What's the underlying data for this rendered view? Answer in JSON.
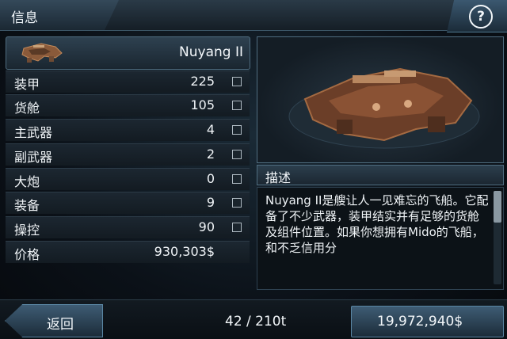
{
  "header": {
    "title": "信息",
    "help_icon": "question-icon"
  },
  "ship": {
    "name": "Nuyang II"
  },
  "stats": [
    {
      "label": "装甲",
      "value": "225"
    },
    {
      "label": "货舱",
      "value": "105"
    },
    {
      "label": "主武器",
      "value": "4"
    },
    {
      "label": "副武器",
      "value": "2"
    },
    {
      "label": "大炮",
      "value": "0"
    },
    {
      "label": "装备",
      "value": "9"
    },
    {
      "label": "操控",
      "value": "90"
    }
  ],
  "price": {
    "label": "价格",
    "value": "930,303$"
  },
  "description": {
    "title": "描述",
    "text": "Nuyang II是艘让人一见难忘的飞船。它配备了不少武器，装甲结实并有足够的货舱及组件位置。如果你想拥有Mido的飞船，和不乏信用分"
  },
  "footer": {
    "back_label": "返回",
    "cargo": "42 / 210t",
    "credits": "19,972,940$"
  },
  "colors": {
    "accent": "#4f7890",
    "panel": "#1a2630"
  }
}
